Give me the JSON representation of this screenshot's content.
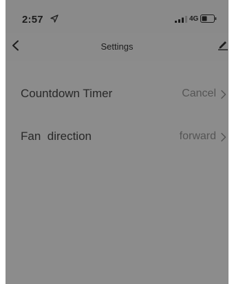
{
  "status_bar": {
    "time": "2:57",
    "network": "4G"
  },
  "nav": {
    "title": "Settings"
  },
  "settings": [
    {
      "label": "Countdown Timer",
      "value": "Cancel"
    },
    {
      "label": "Fan  direction",
      "value": "forward"
    }
  ],
  "colors": {
    "overlay_background": "#8c8c8c",
    "text_primary": "#282828",
    "text_secondary": "#555555"
  }
}
